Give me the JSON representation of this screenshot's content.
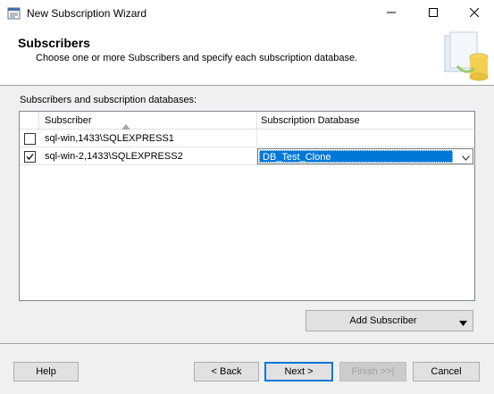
{
  "window": {
    "title": "New Subscription Wizard"
  },
  "header": {
    "title": "Subscribers",
    "description": "Choose one or more Subscribers and specify each subscription database."
  },
  "grid": {
    "label": "Subscribers and subscription databases:",
    "columns": [
      "Subscriber",
      "Subscription Database"
    ],
    "sort_column": "Subscriber",
    "sort_direction": "ascending",
    "rows": [
      {
        "checked": false,
        "subscriber": "sql-win,1433\\SQLEXPRESS1",
        "database": ""
      },
      {
        "checked": true,
        "subscriber": "sql-win-2,1433\\SQLEXPRESS2",
        "database": "DB_Test_Clone"
      }
    ]
  },
  "buttons": {
    "add_subscriber": "Add Subscriber",
    "help": "Help",
    "back": "< Back",
    "next": "Next >",
    "finish": "Finish >>|",
    "cancel": "Cancel"
  },
  "colors": {
    "accent": "#0078d7",
    "window_bg": "#f0f0f0"
  }
}
